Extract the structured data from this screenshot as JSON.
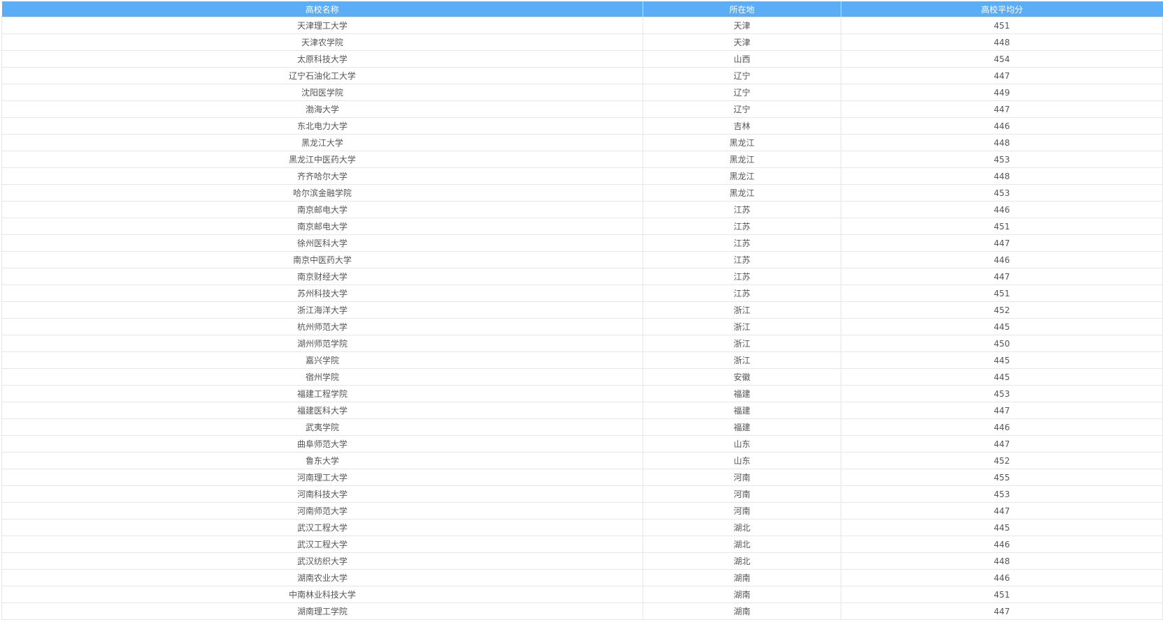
{
  "table": {
    "headers": [
      "高校名称",
      "所在地",
      "高校平均分"
    ],
    "rows": [
      [
        "天津理工大学",
        "天津",
        "451"
      ],
      [
        "天津农学院",
        "天津",
        "448"
      ],
      [
        "太原科技大学",
        "山西",
        "454"
      ],
      [
        "辽宁石油化工大学",
        "辽宁",
        "447"
      ],
      [
        "沈阳医学院",
        "辽宁",
        "449"
      ],
      [
        "渤海大学",
        "辽宁",
        "447"
      ],
      [
        "东北电力大学",
        "吉林",
        "446"
      ],
      [
        "黑龙江大学",
        "黑龙江",
        "448"
      ],
      [
        "黑龙江中医药大学",
        "黑龙江",
        "453"
      ],
      [
        "齐齐哈尔大学",
        "黑龙江",
        "448"
      ],
      [
        "哈尔滨金融学院",
        "黑龙江",
        "453"
      ],
      [
        "南京邮电大学",
        "江苏",
        "446"
      ],
      [
        "南京邮电大学",
        "江苏",
        "451"
      ],
      [
        "徐州医科大学",
        "江苏",
        "447"
      ],
      [
        "南京中医药大学",
        "江苏",
        "446"
      ],
      [
        "南京财经大学",
        "江苏",
        "447"
      ],
      [
        "苏州科技大学",
        "江苏",
        "451"
      ],
      [
        "浙江海洋大学",
        "浙江",
        "452"
      ],
      [
        "杭州师范大学",
        "浙江",
        "445"
      ],
      [
        "湖州师范学院",
        "浙江",
        "450"
      ],
      [
        "嘉兴学院",
        "浙江",
        "445"
      ],
      [
        "宿州学院",
        "安徽",
        "445"
      ],
      [
        "福建工程学院",
        "福建",
        "453"
      ],
      [
        "福建医科大学",
        "福建",
        "447"
      ],
      [
        "武夷学院",
        "福建",
        "446"
      ],
      [
        "曲阜师范大学",
        "山东",
        "447"
      ],
      [
        "鲁东大学",
        "山东",
        "452"
      ],
      [
        "河南理工大学",
        "河南",
        "455"
      ],
      [
        "河南科技大学",
        "河南",
        "453"
      ],
      [
        "河南师范大学",
        "河南",
        "447"
      ],
      [
        "武汉工程大学",
        "湖北",
        "445"
      ],
      [
        "武汉工程大学",
        "湖北",
        "446"
      ],
      [
        "武汉纺织大学",
        "湖北",
        "448"
      ],
      [
        "湖南农业大学",
        "湖南",
        "446"
      ],
      [
        "中南林业科技大学",
        "湖南",
        "451"
      ],
      [
        "湖南理工学院",
        "湖南",
        "447"
      ]
    ]
  },
  "colors": {
    "header_bg": "#5badf5",
    "header_text": "#ffffff",
    "cell_text": "#555555",
    "border": "#e6e6e6"
  }
}
